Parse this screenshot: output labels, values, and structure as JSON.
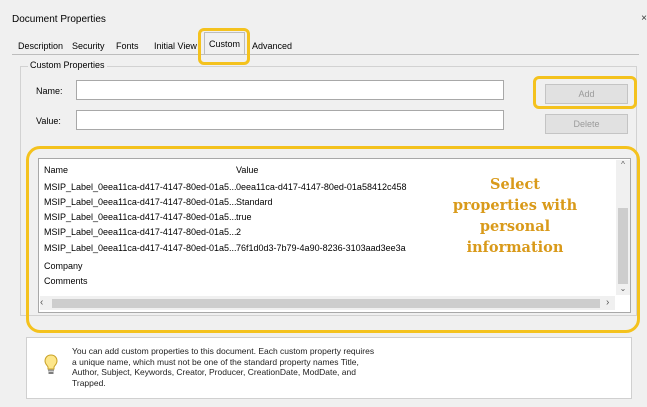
{
  "window": {
    "title": "Document Properties",
    "close_glyph": "×"
  },
  "tabs": [
    {
      "label": "Description"
    },
    {
      "label": "Security"
    },
    {
      "label": "Fonts"
    },
    {
      "label": "Initial View"
    },
    {
      "label": "Custom",
      "selected": true
    },
    {
      "label": "Advanced"
    }
  ],
  "group": {
    "label": "Custom Properties"
  },
  "fields": {
    "name_label": "Name:",
    "name_value": "",
    "value_label": "Value:",
    "value_value": ""
  },
  "buttons": {
    "add": "Add",
    "delete": "Delete"
  },
  "list": {
    "columns": [
      "Name",
      "Value"
    ],
    "rows": [
      {
        "name": "MSIP_Label_0eea11ca-d417-4147-80ed-01a5...",
        "value": "0eea11ca-d417-4147-80ed-01a58412c458"
      },
      {
        "name": "MSIP_Label_0eea11ca-d417-4147-80ed-01a5...",
        "value": "Standard"
      },
      {
        "name": "MSIP_Label_0eea11ca-d417-4147-80ed-01a5...",
        "value": "true"
      },
      {
        "name": "MSIP_Label_0eea11ca-d417-4147-80ed-01a5...",
        "value": "2"
      },
      {
        "name": "MSIP_Label_0eea11ca-d417-4147-80ed-01a5...",
        "value": "76f1d0d3-7b79-4a90-8236-3103aad3ee3a"
      },
      {
        "name": "Company",
        "value": ""
      },
      {
        "name": "Comments",
        "value": ""
      }
    ]
  },
  "callout": {
    "line1": "Select",
    "line2": "properties with",
    "line3": "personal",
    "line4": "information"
  },
  "info": {
    "line1": "You can add custom properties to this document. Each custom property requires",
    "line2": "a unique name, which must not be one of the standard property names Title,",
    "line3": "Author, Subject, Keywords, Creator, Producer, CreationDate, ModDate, and",
    "line4": "Trapped."
  },
  "colors": {
    "highlight": "#f4c21e",
    "callout_text": "#d99a1a"
  },
  "icons": {
    "info": "lightbulb-icon"
  }
}
